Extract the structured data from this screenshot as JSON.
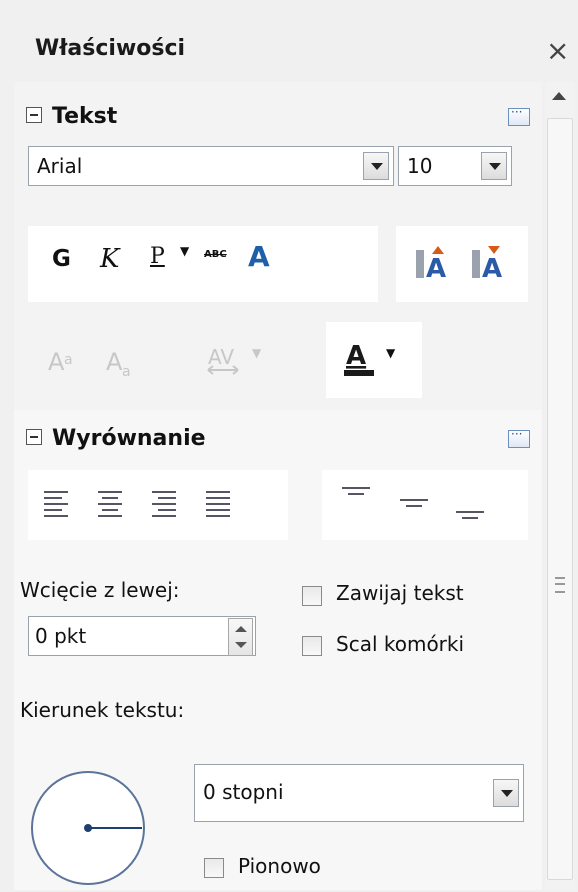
{
  "panel": {
    "title": "Właściwości",
    "close_glyph": "×"
  },
  "tekst": {
    "title": "Tekst",
    "font_name": "Arial",
    "font_size": "10",
    "format": {
      "bold": "G",
      "italic": "K",
      "underline": "P",
      "strikethrough": "ABC",
      "shadow": "A"
    }
  },
  "wyrownanie": {
    "title": "Wyrównanie",
    "indent_label": "Wcięcie z lewej:",
    "indent_value": "0 pkt",
    "wrap_label": "Zawijaj tekst",
    "merge_label": "Scal komórki",
    "direction_label": "Kierunek tekstu:",
    "angle_value": "0 stopni",
    "vertical_label": "Pionowo"
  },
  "colors": {
    "accent": "#2a4c87",
    "panel_bg": "#f3f3f3",
    "font_color_underline": "#1a1a1a"
  }
}
